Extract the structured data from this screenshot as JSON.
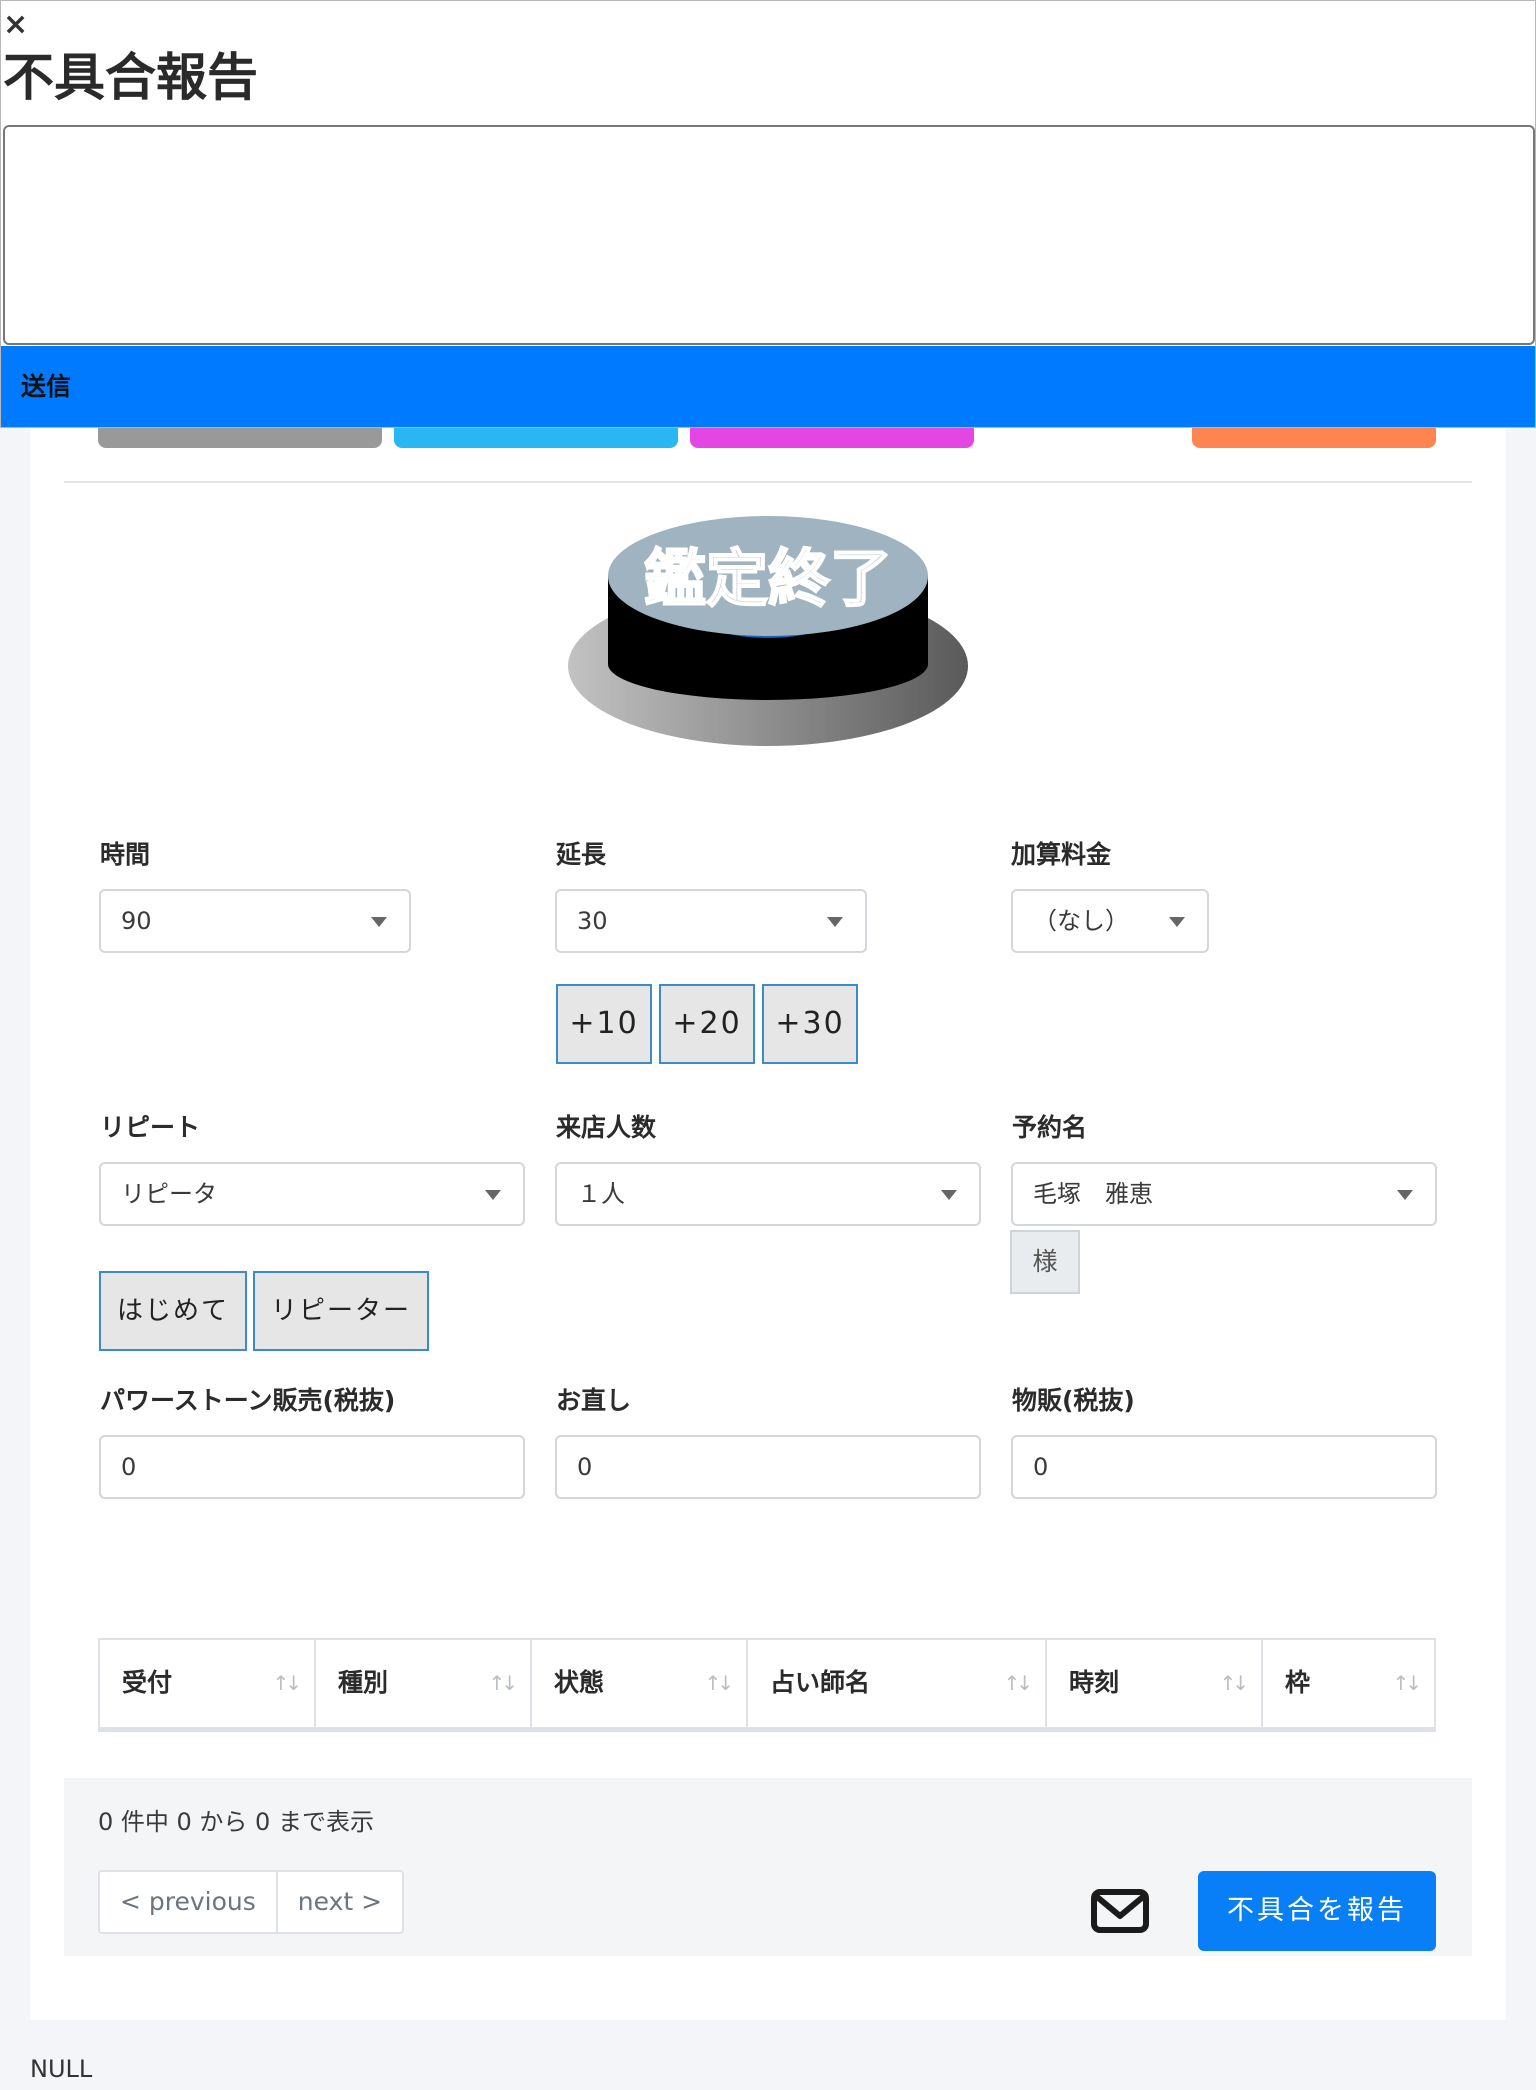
{
  "modal": {
    "close_label": "×",
    "title": "不具合報告",
    "textarea_value": "",
    "send_label": "送信"
  },
  "colors": {
    "gray_button": "#999999",
    "cyan_button": "#29b6f2",
    "magenta_button": "#e446e4",
    "orange_button": "#ff8550",
    "primary": "#007bff"
  },
  "end_button": {
    "label": "鑑定終了"
  },
  "form": {
    "time": {
      "label": "時間",
      "value": "90"
    },
    "extension": {
      "label": "延長",
      "value": "30",
      "quick_buttons": [
        "+10",
        "+20",
        "+30"
      ]
    },
    "extra_fee": {
      "label": "加算料金",
      "value": "（なし）"
    },
    "repeat": {
      "label": "リピート",
      "value": "リピータ",
      "quick_buttons": [
        "はじめて",
        "リピーター"
      ]
    },
    "visitors": {
      "label": "来店人数",
      "value": "１人"
    },
    "reservation_name": {
      "label": "予約名",
      "value": "毛塚　雅恵",
      "suffix": "様"
    },
    "powerstone": {
      "label": "パワーストーン販売(税抜)",
      "value": "0"
    },
    "repair": {
      "label": "お直し",
      "value": "0"
    },
    "goods": {
      "label": "物販(税抜)",
      "value": "0"
    }
  },
  "table": {
    "columns": [
      "受付",
      "種別",
      "状態",
      "占い師名",
      "時刻",
      "枠"
    ],
    "sort_icon": "sort-arrows-icon"
  },
  "footer": {
    "info": "0 件中 0 から 0 まで表示",
    "prev_label": "< previous",
    "next_label": "next >",
    "mail_icon": "envelope-icon",
    "report_label": "不具合を報告"
  },
  "null_text": "NULL"
}
